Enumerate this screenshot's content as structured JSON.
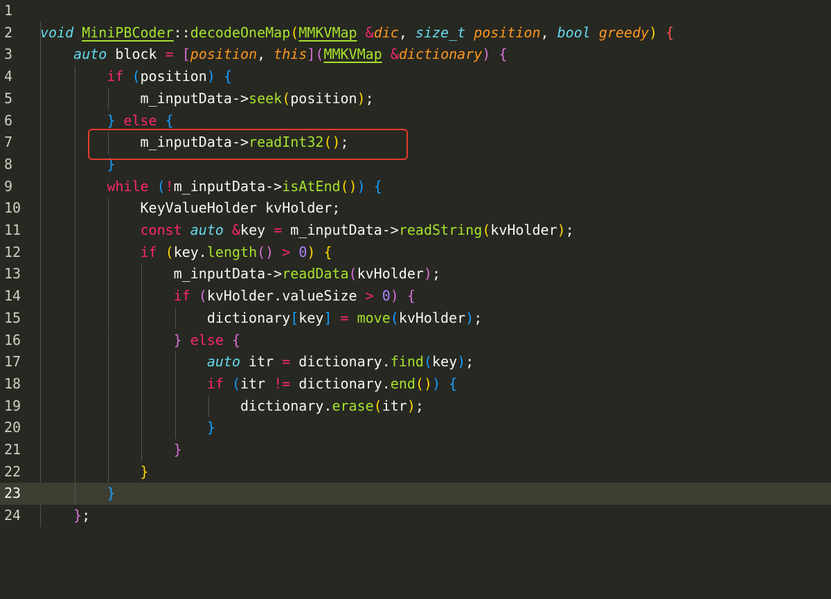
{
  "editor": {
    "current_line": 23,
    "highlighted_line": 7,
    "lines": [
      {
        "n": "1",
        "html": ""
      },
      {
        "n": "2",
        "html": "<span class=\"type\">void</span> <span class=\"typebox\">MiniPBCoder</span>::<span class=\"fn\">decodeOneMap</span><span class=\"b1\">(</span><span class=\"typebox\">MMKVMap</span> <span class=\"kw\">&amp;</span><span class=\"param\">dic</span>, <span class=\"type\">size_t</span> <span class=\"param\">position</span>, <span class=\"type\">bool</span> <span class=\"param\">greedy</span><span class=\"b1\">)</span> <span class=\"bred\">{</span>"
      },
      {
        "n": "3",
        "html": "    <span class=\"type\">auto</span> block <span class=\"kw\">=</span> <span class=\"b2\">[</span><span class=\"param\">position</span>, <span class=\"param\">this</span><span class=\"b2\">]</span><span class=\"b2\">(</span><span class=\"typebox\">MMKVMap</span> <span class=\"kw\">&amp;</span><span class=\"param\">dictionary</span><span class=\"b2\">)</span> <span class=\"b2\">{</span>"
      },
      {
        "n": "4",
        "html": "        <span class=\"kw\">if</span> <span class=\"b3\">(</span>position<span class=\"b3\">)</span> <span class=\"b3\">{</span>"
      },
      {
        "n": "5",
        "html": "            m_inputData-&gt;<span class=\"fn\">seek</span><span class=\"b1\">(</span>position<span class=\"b1\">)</span>;"
      },
      {
        "n": "6",
        "html": "        <span class=\"b3\">}</span> <span class=\"kw\">else</span> <span class=\"b3\">{</span>"
      },
      {
        "n": "7",
        "html": "            m_inputData-&gt;<span class=\"fn\">readInt32</span><span class=\"b1\">()</span>;"
      },
      {
        "n": "8",
        "html": "        <span class=\"b3\">}</span>"
      },
      {
        "n": "9",
        "html": "        <span class=\"kw\">while</span> <span class=\"b3\">(</span><span class=\"kw\">!</span>m_inputData-&gt;<span class=\"fn\">isAtEnd</span><span class=\"b1\">()</span><span class=\"b3\">)</span> <span class=\"b3\">{</span>"
      },
      {
        "n": "10",
        "html": "            KeyValueHolder kvHolder;"
      },
      {
        "n": "11",
        "html": "            <span class=\"kw\">const</span> <span class=\"type\">auto</span> <span class=\"kw\">&amp;</span>key <span class=\"kw\">=</span> m_inputData-&gt;<span class=\"fn\">readString</span><span class=\"b1\">(</span>kvHolder<span class=\"b1\">)</span>;"
      },
      {
        "n": "12",
        "html": "            <span class=\"kw\">if</span> <span class=\"b1\">(</span>key.<span class=\"fn\">length</span><span class=\"b2\">()</span> <span class=\"kw\">&gt;</span> <span class=\"num\">0</span><span class=\"b1\">)</span> <span class=\"b1\">{</span>"
      },
      {
        "n": "13",
        "html": "                m_inputData-&gt;<span class=\"fn\">readData</span><span class=\"b2\">(</span>kvHolder<span class=\"b2\">)</span>;"
      },
      {
        "n": "14",
        "html": "                <span class=\"kw\">if</span> <span class=\"b2\">(</span>kvHolder.valueSize <span class=\"kw\">&gt;</span> <span class=\"num\">0</span><span class=\"b2\">)</span> <span class=\"b2\">{</span>"
      },
      {
        "n": "15",
        "html": "                    dictionary<span class=\"b3\">[</span>key<span class=\"b3\">]</span> <span class=\"kw\">=</span> <span class=\"fn\">move</span><span class=\"b3\">(</span>kvHolder<span class=\"b3\">)</span>;"
      },
      {
        "n": "16",
        "html": "                <span class=\"b2\">}</span> <span class=\"kw\">else</span> <span class=\"b2\">{</span>"
      },
      {
        "n": "17",
        "html": "                    <span class=\"type\">auto</span> itr <span class=\"kw\">=</span> dictionary.<span class=\"fn\">find</span><span class=\"b3\">(</span>key<span class=\"b3\">)</span>;"
      },
      {
        "n": "18",
        "html": "                    <span class=\"kw\">if</span> <span class=\"b3\">(</span>itr <span class=\"kw\">!=</span> dictionary.<span class=\"fn\">end</span><span class=\"b1\">()</span><span class=\"b3\">)</span> <span class=\"b3\">{</span>"
      },
      {
        "n": "19",
        "html": "                        dictionary.<span class=\"fn\">erase</span><span class=\"b1\">(</span>itr<span class=\"b1\">)</span>;"
      },
      {
        "n": "20",
        "html": "                    <span class=\"b3\">}</span>"
      },
      {
        "n": "21",
        "html": "                <span class=\"b2\">}</span>"
      },
      {
        "n": "22",
        "html": "            <span class=\"b1\">}</span>"
      },
      {
        "n": "23",
        "html": "        <span class=\"b3\">}</span>"
      },
      {
        "n": "24",
        "html": "    <span class=\"b2\">}</span>;"
      }
    ]
  }
}
